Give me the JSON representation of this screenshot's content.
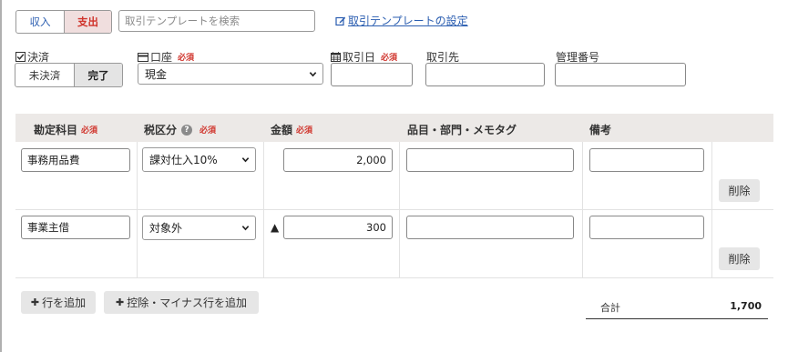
{
  "type_toggle": {
    "income_label": "収入",
    "expense_label": "支出"
  },
  "template": {
    "search_placeholder": "取引テンプレートを検索",
    "settings_link": "取引テンプレートの設定"
  },
  "settlement": {
    "label": "決済",
    "unsettled_label": "未決済",
    "settled_label": "完了"
  },
  "account": {
    "label": "口座",
    "required": "必須",
    "value": "現金"
  },
  "transaction_date": {
    "label": "取引日",
    "required": "必須",
    "value": ""
  },
  "partner": {
    "label": "取引先",
    "value": ""
  },
  "management_number": {
    "label": "管理番号",
    "value": ""
  },
  "table": {
    "headers": {
      "account_item": "勘定科目",
      "tax": "税区分",
      "amount": "金額",
      "item_dept_memo": "品目・部門・メモタグ",
      "remarks": "備考"
    },
    "required": "必須",
    "help_icon": "?",
    "rows": [
      {
        "account_item": "事務用品費",
        "tax": "課対仕入10%",
        "marker": "",
        "amount": "2,000",
        "tags": "",
        "remarks": "",
        "delete_label": "削除"
      },
      {
        "account_item": "事業主借",
        "tax": "対象外",
        "marker": "▲",
        "amount": "300",
        "tags": "",
        "remarks": "",
        "delete_label": "削除"
      }
    ]
  },
  "actions": {
    "add_row": "行を追加",
    "add_deduction_row": "控除・マイナス行を追加",
    "plus_glyph": "✚"
  },
  "total": {
    "label": "合計",
    "value": "1,700"
  }
}
